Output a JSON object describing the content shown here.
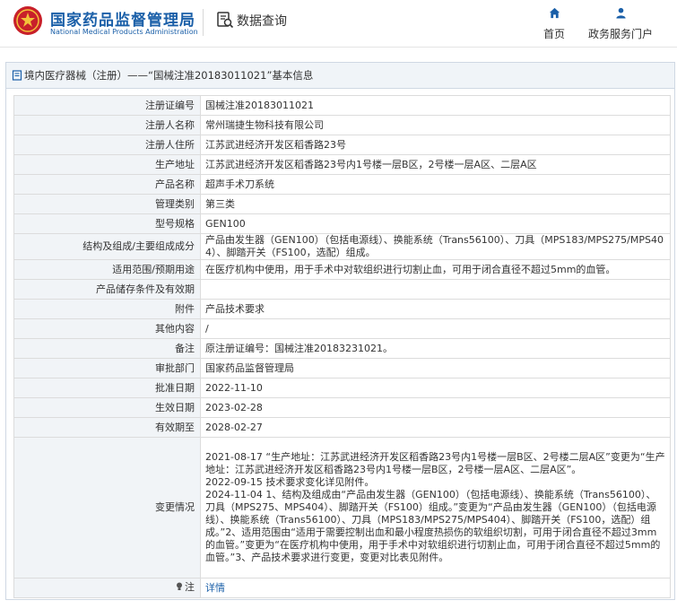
{
  "header": {
    "brand_cn": "国家药品监督管理局",
    "brand_en": "National Medical Products Administration",
    "query": "数据查询",
    "nav_home": "首页",
    "nav_gov": "政务服务门户"
  },
  "breadcrumb": "境内医疗器械（注册）——“国械注准20183011021”基本信息",
  "rows": [
    {
      "label": "注册证编号",
      "value": "国械注准20183011021"
    },
    {
      "label": "注册人名称",
      "value": "常州瑞捷生物科技有限公司"
    },
    {
      "label": "注册人住所",
      "value": "江苏武进经济开发区稻香路23号"
    },
    {
      "label": "生产地址",
      "value": "江苏武进经济开发区稻香路23号内1号楼一层B区，2号楼一层A区、二层A区"
    },
    {
      "label": "产品名称",
      "value": "超声手术刀系统"
    },
    {
      "label": "管理类别",
      "value": "第三类"
    },
    {
      "label": "型号规格",
      "value": "GEN100"
    },
    {
      "label": "结构及组成/主要组成成分",
      "value": "产品由发生器（GEN100）（包括电源线）、换能系统（Trans56100）、刀具（MPS183/MPS275/MPS404）、脚踏开关（FS100，选配）组成。"
    },
    {
      "label": "适用范围/预期用途",
      "value": "在医疗机构中使用，用于手术中对软组织进行切割止血，可用于闭合直径不超过5mm的血管。"
    },
    {
      "label": "产品储存条件及有效期",
      "value": ""
    },
    {
      "label": "附件",
      "value": "产品技术要求"
    },
    {
      "label": "其他内容",
      "value": "/"
    },
    {
      "label": "备注",
      "value": "原注册证编号：国械注准20183231021。"
    },
    {
      "label": "审批部门",
      "value": "国家药品监督管理局"
    },
    {
      "label": "批准日期",
      "value": "2022-11-10"
    },
    {
      "label": "生效日期",
      "value": "2023-02-28"
    },
    {
      "label": "有效期至",
      "value": "2028-02-27"
    }
  ],
  "change": {
    "label": "变更情况",
    "lines": [
      "2021-08-17 “生产地址：江苏武进经济开发区稻香路23号内1号楼一层B区、2号楼二层A区”变更为“生产地址：江苏武进经济开发区稻香路23号内1号楼一层B区，2号楼一层A区、二层A区”。",
      "2022-09-15 技术要求变化详见附件。",
      "2024-11-04 1、结构及组成由“产品由发生器（GEN100）（包括电源线）、换能系统（Trans56100）、刀具（MPS275、MPS404）、脚踏开关（FS100）组成。”变更为“产品由发生器（GEN100）（包括电源线）、换能系统（Trans56100）、刀具（MPS183/MPS275/MPS404）、脚踏开关（FS100，选配）组成。”2、适用范围由“适用于需要控制出血和最小程度热损伤的软组织切割，可用于闭合直径不超过3mm的血管。”变更为“在医疗机构中使用，用于手术中对软组织进行切割止血，可用于闭合直径不超过5mm的血管。”3、产品技术要求进行变更，变更对比表见附件。"
    ]
  },
  "note": {
    "label": "注",
    "value": "详情"
  }
}
